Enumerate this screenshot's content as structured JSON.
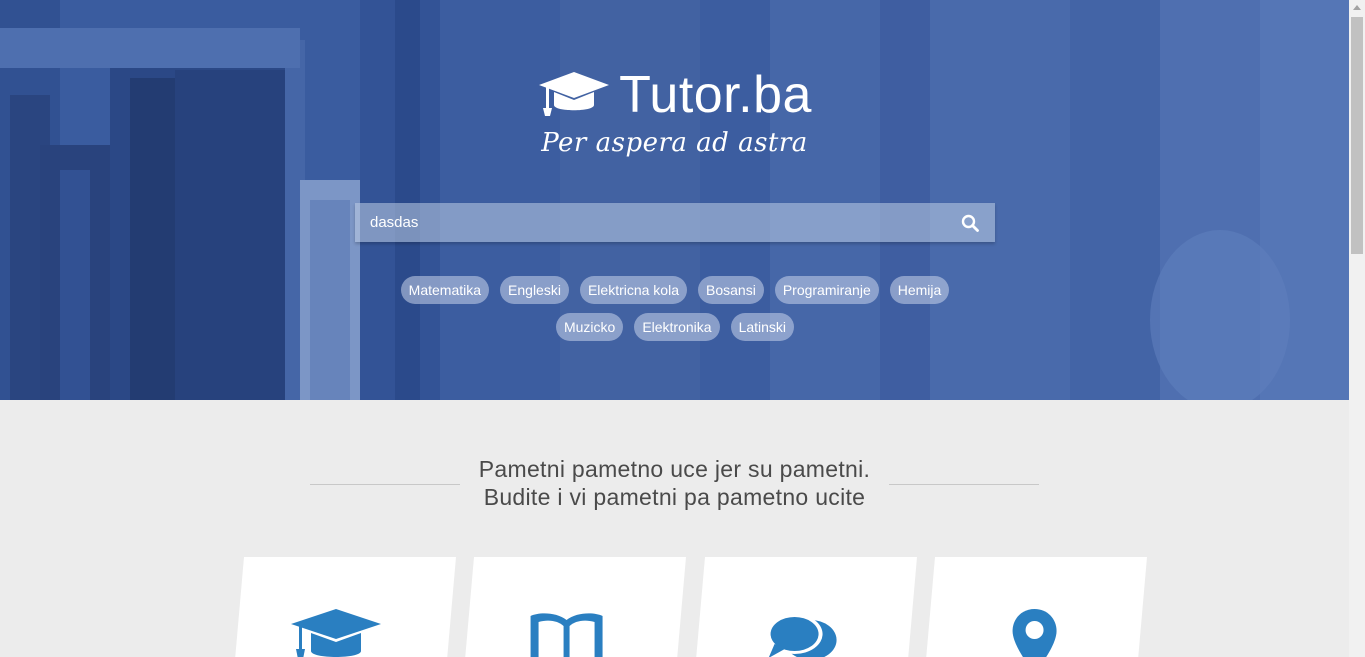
{
  "brand": {
    "title": "Tutor.ba",
    "tagline": "Per aspera ad astra",
    "icon": "graduation-cap-icon",
    "color": "#ffffff"
  },
  "search": {
    "value": "dasdas",
    "icon": "search-icon"
  },
  "tags": [
    "Matematika",
    "Engleski",
    "Elektricna kola",
    "Bosansi",
    "Programiranje",
    "Hemija",
    "Muzicko",
    "Elektronika",
    "Latinski"
  ],
  "section": {
    "headline_line1": "Pametni pametno uce jer su pametni.",
    "headline_line2": "Budite i vi pametni pa pametno ucite"
  },
  "features": [
    {
      "icon": "graduation-cap-icon"
    },
    {
      "icon": "open-book-icon"
    },
    {
      "icon": "chat-bubbles-icon"
    },
    {
      "icon": "map-pin-icon"
    }
  ],
  "colors": {
    "accent": "#2a7fc1",
    "hero_blue": "#3d5f9e",
    "background": "#ececec"
  }
}
